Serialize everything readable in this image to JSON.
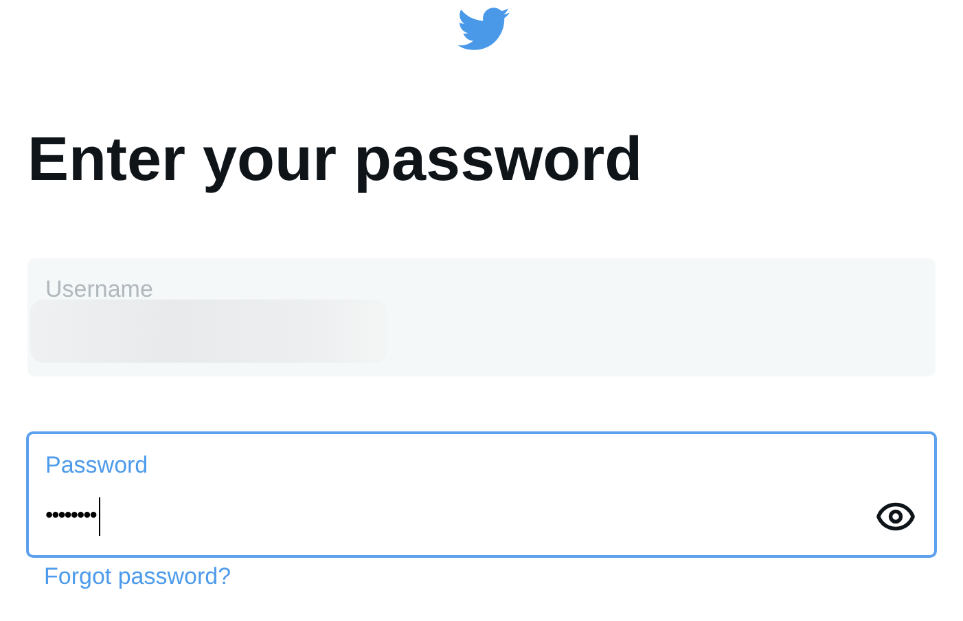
{
  "heading": "Enter your password",
  "username_field": {
    "label": "Username",
    "disabled": true
  },
  "password_field": {
    "label": "Password",
    "value": "••••••••",
    "focused": true
  },
  "forgot_link": "Forgot password?"
}
